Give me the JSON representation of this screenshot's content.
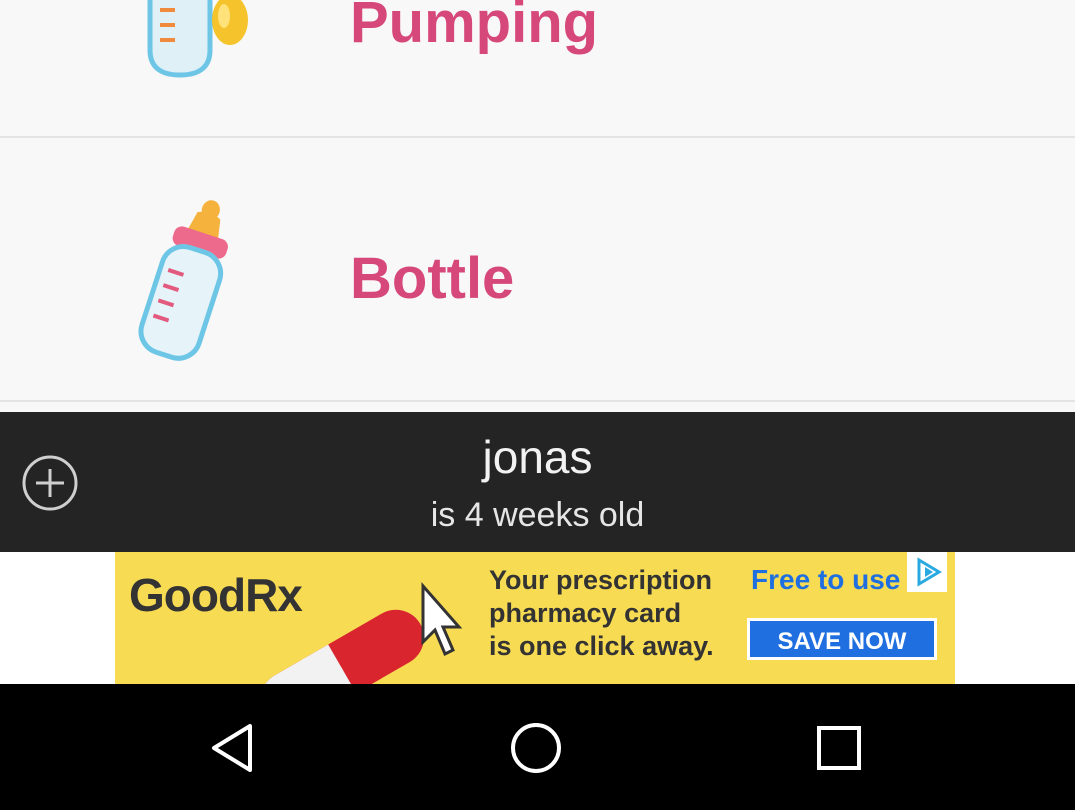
{
  "feed_types": [
    {
      "label": "Pumping",
      "icon": "breast-pump-bottle-icon"
    },
    {
      "label": "Bottle",
      "icon": "baby-bottle-icon"
    }
  ],
  "profile": {
    "name": "jonas",
    "age_text": "is 4 weeks old",
    "add_icon": "plus-circle-icon"
  },
  "ad": {
    "brand": "GoodRx",
    "headline_line1": "Your prescription",
    "headline_line2": "pharmacy card",
    "headline_line3": "is one click away.",
    "tagline": "Free to use",
    "cta": "SAVE NOW",
    "colors": {
      "background": "#f7db53",
      "accent": "#1f6fe0"
    }
  },
  "nav": {
    "back_icon": "back-triangle-icon",
    "home_icon": "home-circle-icon",
    "recents_icon": "recents-square-icon"
  },
  "colors": {
    "label": "#d6487a",
    "bar": "#242424"
  }
}
